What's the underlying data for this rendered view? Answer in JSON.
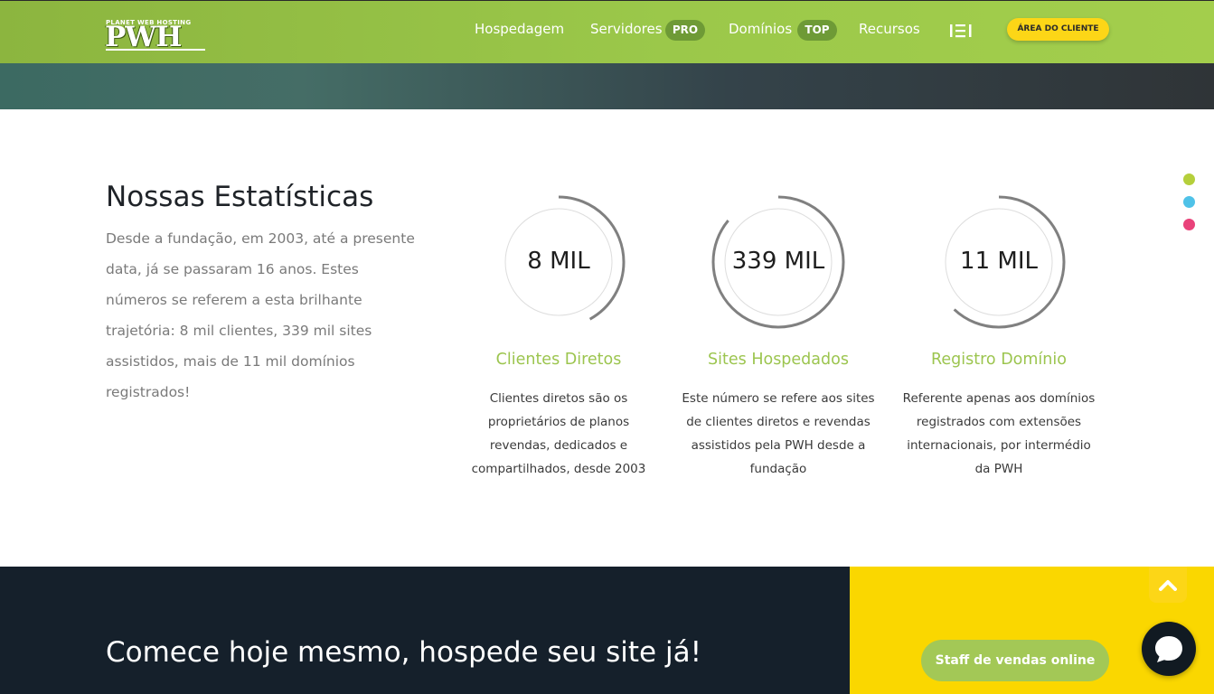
{
  "header": {
    "logo_sub": "PLANET WEB HOSTING",
    "logo_main": "PWH",
    "nav": [
      {
        "label": "Hospedagem"
      },
      {
        "label": "Servidores",
        "badge": "PRO"
      },
      {
        "label": "Domínios",
        "badge": "TOP"
      },
      {
        "label": "Recursos"
      }
    ],
    "client_button": "ÁREA DO CLIENTE"
  },
  "stats": {
    "title": "Nossas Estatísticas",
    "description": "Desde a fundação, em 2003, até a presente data, já se passaram 16 anos. Estes números se referem a esta brilhante trajetória: 8 mil clientes, 339 mil sites assistidos, mais de 11 mil domínios registrados!",
    "items": [
      {
        "value": "8 MIL",
        "title": "Clientes Diretos",
        "description": "Clientes diretos são os proprietários de planos revendas, dedicados e compartilhados, desde 2003",
        "progress": 0.42
      },
      {
        "value": "339 MIL",
        "title": "Sites Hospedados",
        "description": "Este número se refere aos sites de clientes diretos e revendas assistidos pela PWH desde a fundação",
        "progress": 0.86
      },
      {
        "value": "11 MIL",
        "title": "Registro Domínio",
        "description": "Referente apenas aos domínios registrados com extensões internacionais, por intermédio da PWH",
        "progress": 0.62
      }
    ]
  },
  "side_dots": [
    "#b5cf3b",
    "#4fc2e8",
    "#e9427a"
  ],
  "bottom": {
    "cta_title": "Comece hoje mesmo, hospede seu site já!",
    "sales_button": "Staff de vendas online"
  },
  "icons": {
    "menu": "menu-icon",
    "scroll_top": "chevron-up-icon",
    "chat": "chat-bubble-icon"
  },
  "colors": {
    "accent_green": "#9cc54f",
    "yellow": "#fad700",
    "dark": "#15202b"
  }
}
